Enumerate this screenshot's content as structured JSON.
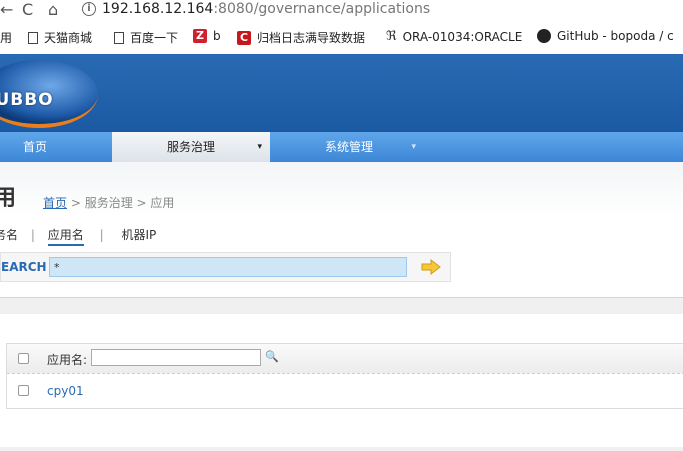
{
  "browser": {
    "back_glyph": "←",
    "reload_glyph": "C",
    "home_glyph": "⌂",
    "info_glyph": "i",
    "url_host": "192.168.12.164",
    "url_rest": ":8080/governance/applications"
  },
  "bookmarks": [
    {
      "label": "用",
      "icon": "none"
    },
    {
      "label": "天猫商城",
      "icon": "page-icon"
    },
    {
      "label": "百度一下",
      "icon": "page-icon"
    },
    {
      "label": "b",
      "icon": "zhihu-icon",
      "icon_text": "Z"
    },
    {
      "label": "归档日志满导致数据",
      "icon": "csdn-icon",
      "icon_text": "C"
    },
    {
      "label": "ORA-01034:ORACLE",
      "icon": "oracle-icon",
      "icon_text": "ℜ"
    },
    {
      "label": "GitHub - bopoda / c",
      "icon": "github-icon"
    }
  ],
  "header": {
    "logo_text": "OUBBO"
  },
  "menu": {
    "home": "首页",
    "governance": "服务治理",
    "governance_caret": "▾",
    "system": "系统管理",
    "system_caret": "▾"
  },
  "page": {
    "title": "用",
    "breadcrumb_home": "首页",
    "breadcrumb_rest": " > 服务治理 > 应用"
  },
  "tabs": {
    "service_name": "务名",
    "app_name": "应用名",
    "machine_ip": "机器IP",
    "sep": "|"
  },
  "search": {
    "label": "EARCH",
    "value": "*"
  },
  "table": {
    "header_label": "应用名:",
    "filter_value": "",
    "search_glyph": "🔍",
    "rows": [
      {
        "name": "cpy01"
      }
    ]
  },
  "colors": {
    "brand_blue": "#1b5aa3",
    "link_blue": "#2a6ab4",
    "menu_blue": "#3d86d6",
    "logo_orange": "#e87e1c"
  }
}
